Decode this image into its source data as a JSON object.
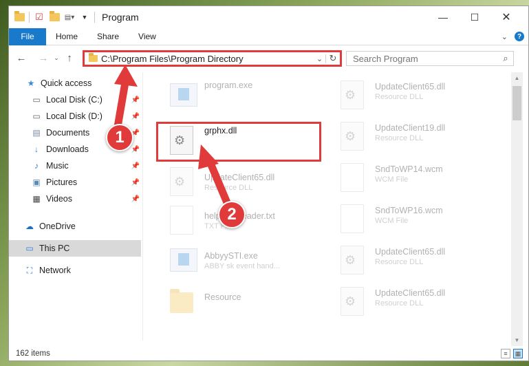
{
  "window": {
    "title": "Program"
  },
  "ribbon": {
    "tabs": [
      "File",
      "Home",
      "Share",
      "View"
    ],
    "help": "?"
  },
  "address": {
    "path": "C:\\Program Files\\Program Directory",
    "dropdown": "⌄",
    "refresh": "↻"
  },
  "search": {
    "placeholder": "Search Program"
  },
  "sidebar": {
    "items": [
      {
        "label": "Quick access",
        "icon": "star-icon"
      },
      {
        "label": "Local Disk (C:)",
        "icon": "drive-icon"
      },
      {
        "label": "Local Disk (D:)",
        "icon": "drive-icon"
      },
      {
        "label": "Documents",
        "icon": "documents-icon"
      },
      {
        "label": "Downloads",
        "icon": "download-icon"
      },
      {
        "label": "Music",
        "icon": "music-icon"
      },
      {
        "label": "Pictures",
        "icon": "pictures-icon"
      },
      {
        "label": "Videos",
        "icon": "videos-icon"
      },
      {
        "label": "OneDrive",
        "icon": "cloud-icon"
      },
      {
        "label": "This PC",
        "icon": "computer-icon"
      },
      {
        "label": "Network",
        "icon": "network-icon"
      }
    ]
  },
  "files": {
    "left": [
      {
        "name": "program.exe",
        "type": ""
      },
      {
        "name": "grphx.dll",
        "type": ""
      },
      {
        "name": "UpdateClient65.dll",
        "type": "Resource DLL"
      },
      {
        "name": "help first reader.txt",
        "type": "TXT File"
      },
      {
        "name": "AbbyySTI.exe",
        "type": "ABBY sk event hand..."
      },
      {
        "name": "Resource",
        "type": ""
      }
    ],
    "right": [
      {
        "name": "UpdateClient65.dll",
        "type": "Resource DLL"
      },
      {
        "name": "UpdateClient19.dll",
        "type": "Resource DLL"
      },
      {
        "name": "SndToWP14.wcm",
        "type": "WCM File"
      },
      {
        "name": "SndToWP16.wcm",
        "type": "WCM File"
      },
      {
        "name": "UpdateClient65.dll",
        "type": "Resource DLL"
      },
      {
        "name": "UpdateClient65.dll",
        "type": "Resource DLL"
      }
    ]
  },
  "status": {
    "count": "162 items"
  },
  "annotations": {
    "step1": "1",
    "step2": "2",
    "color": "#e03a3a"
  }
}
